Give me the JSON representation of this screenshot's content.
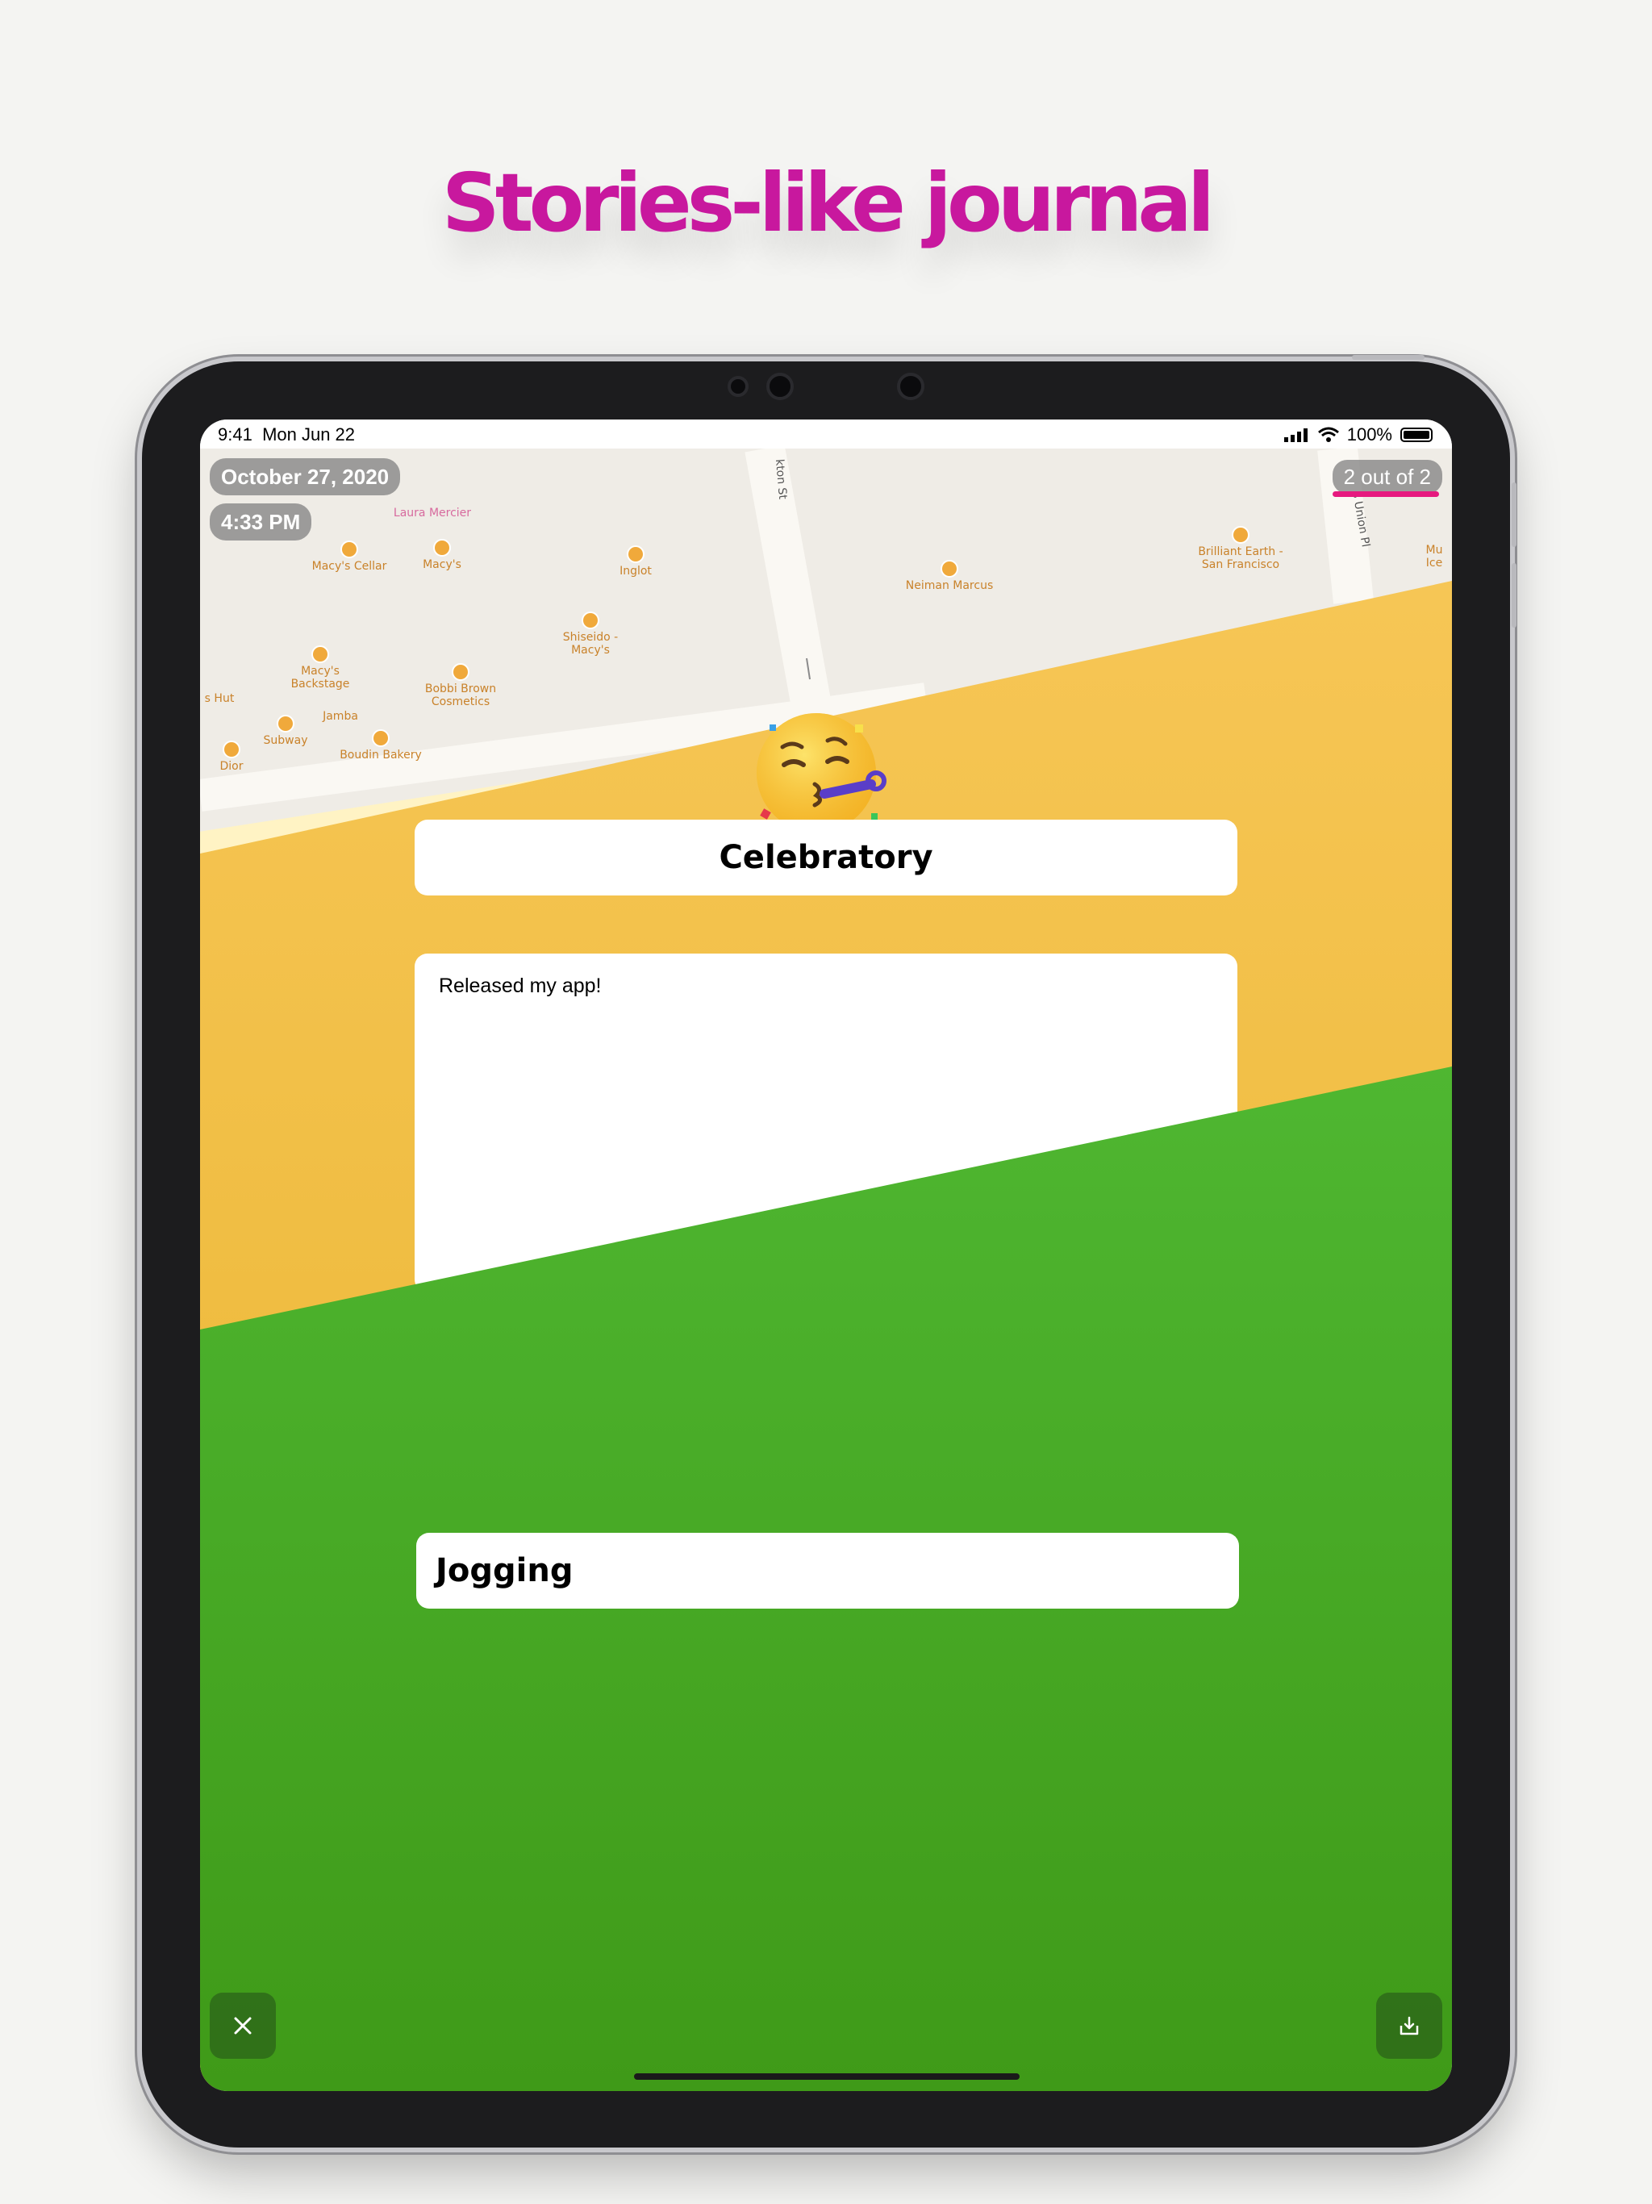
{
  "headline": "Stories-like journal",
  "status_bar": {
    "time": "9:41",
    "date": "Mon Jun 22",
    "battery": "100%"
  },
  "entry": {
    "date": "October 27, 2020",
    "time": "4:33 PM",
    "counter": "2 out of 2",
    "mood": "Celebratory",
    "mood_emoji": "partying-face",
    "note": "Released my app!",
    "activity": "Jogging"
  },
  "map": {
    "streets": [
      "kton St",
      "s Union Pl"
    ],
    "places": [
      "Laura Mercier",
      "Macy's Cellar",
      "Macy's",
      "Inglot",
      "Neiman Marcus",
      "Brilliant Earth - San Francisco",
      "Shiseido - Macy's",
      "Macy's Backstage",
      "Bobbi Brown Cosmetics",
      "s Hut",
      "Jamba",
      "Subway",
      "Boudin Bakery",
      "Dior",
      "Mu Ice"
    ]
  },
  "colors": {
    "headline": "#c8189e",
    "mood_card": "#f8c85a",
    "activity_card": "#59c941",
    "progress": "#e6197f"
  },
  "icons": {
    "close": "close-icon",
    "export": "export-icon"
  }
}
